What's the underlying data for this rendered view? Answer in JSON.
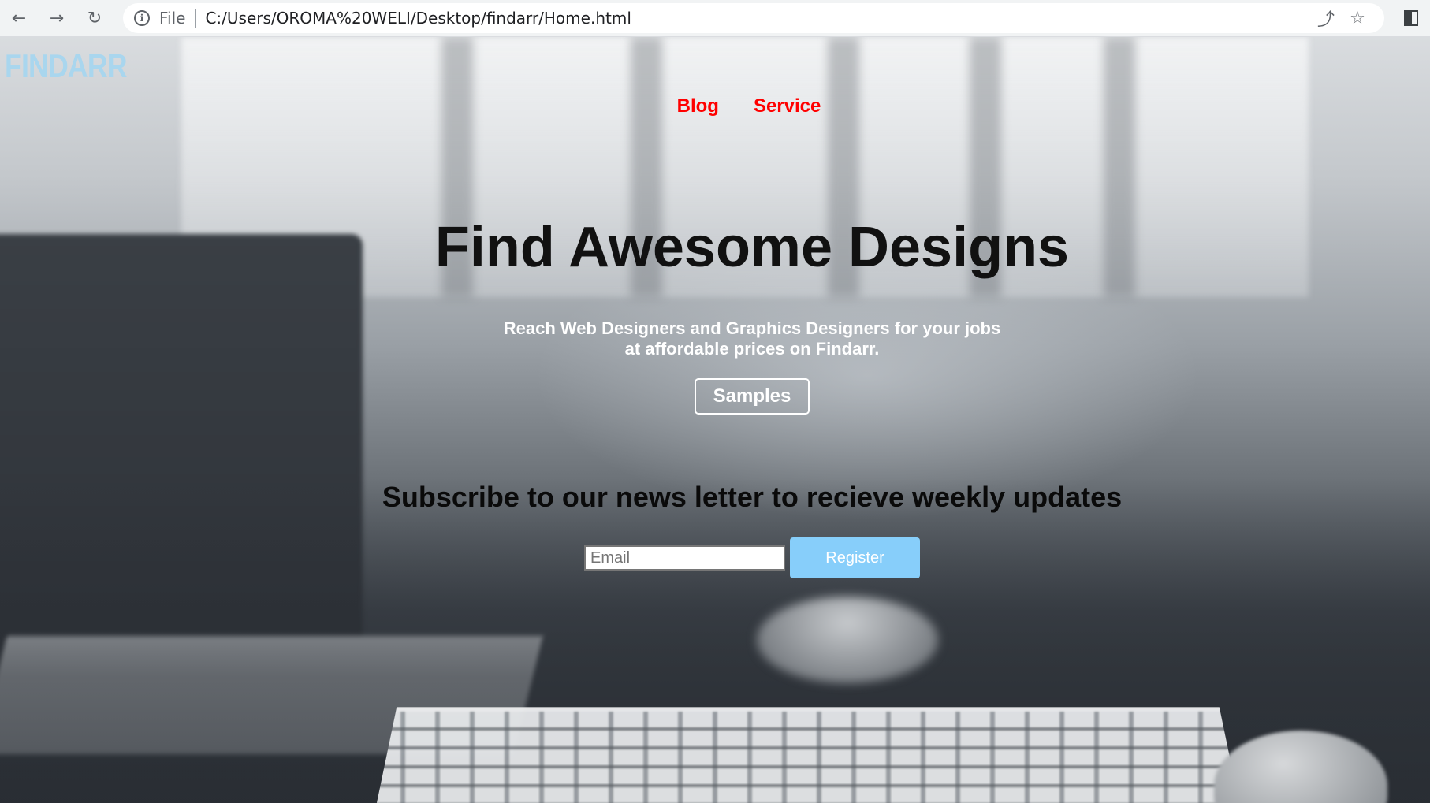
{
  "browser": {
    "scheme_label": "File",
    "url": "C:/Users/OROMA%20WELI/Desktop/findarr/Home.html",
    "back_icon": "←",
    "forward_icon": "→",
    "reload_icon": "↻",
    "info_icon": "i",
    "share_icon": "⤴",
    "star_icon": "☆"
  },
  "header": {
    "logo": "FINDARR",
    "nav": [
      {
        "label": "Blog"
      },
      {
        "label": "Service"
      }
    ]
  },
  "hero": {
    "title": "Find Awesome Designs",
    "subtitle_line1": "Reach Web Designers and Graphics Designers for your jobs",
    "subtitle_line2": "at affordable prices on Findarr.",
    "samples_label": "Samples"
  },
  "newsletter": {
    "title": "Subscribe to our news letter to recieve weekly updates",
    "email_placeholder": "Email",
    "email_value": "",
    "register_label": "Register"
  },
  "colors": {
    "logo": "#a9d6ee",
    "nav_link": "#ff0000",
    "register_bg": "#87cefa"
  }
}
